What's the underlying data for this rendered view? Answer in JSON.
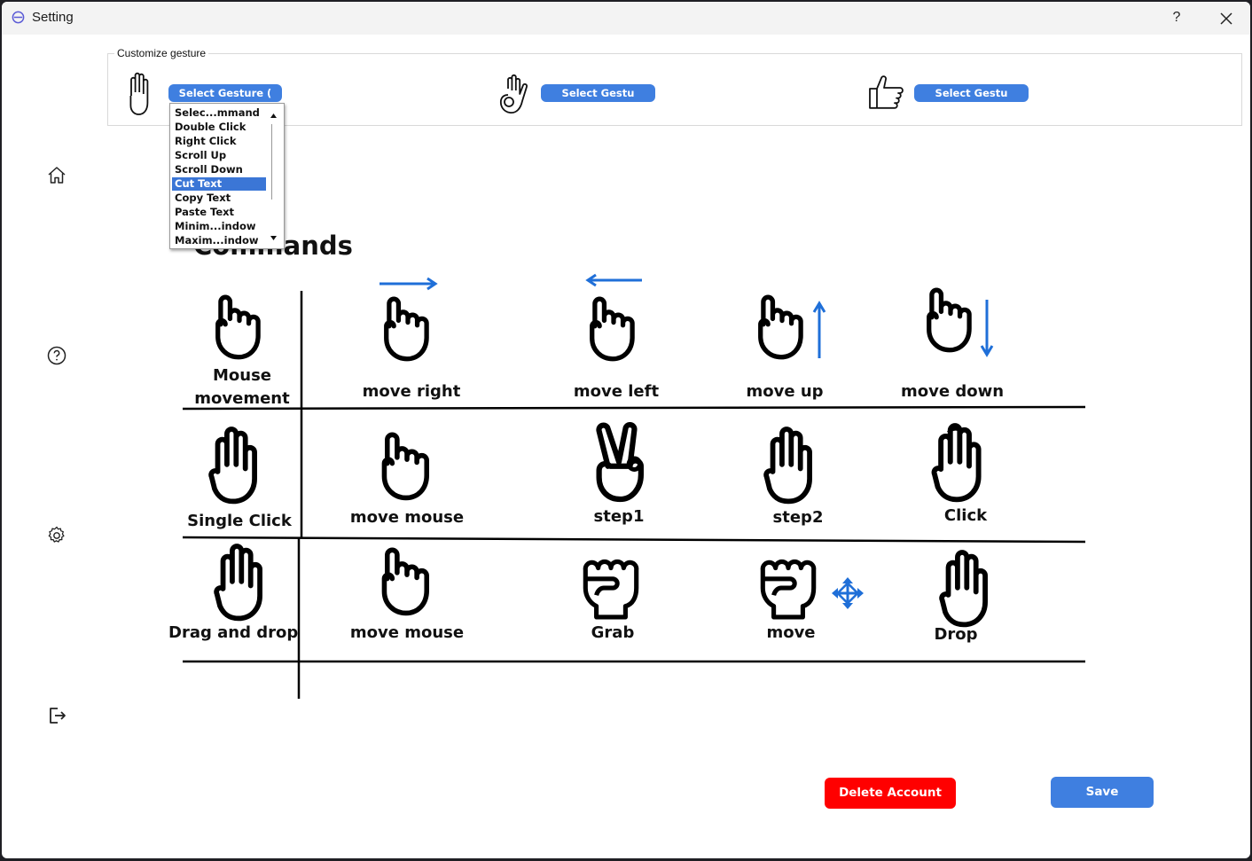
{
  "window": {
    "title": "Setting",
    "help_label": "?"
  },
  "sidebar": {
    "items": [
      {
        "name": "home-icon"
      },
      {
        "name": "help-circle-icon"
      },
      {
        "name": "gear-icon"
      },
      {
        "name": "logout-icon"
      }
    ]
  },
  "customize": {
    "group_title": "Customize gesture",
    "selects": [
      {
        "label": "Select Gesture (",
        "icon": "open-palm-icon"
      },
      {
        "label": "Select Gestu",
        "icon": "ok-hand-icon"
      },
      {
        "label": "Select Gestu",
        "icon": "thumbs-side-hand-icon"
      }
    ],
    "dropdown_options": [
      "Selec...mmand",
      "Double Click",
      "Right Click",
      "Scroll Up",
      "Scroll Down",
      "Cut Text",
      "Copy Text",
      "Paste Text",
      "Minim...indow",
      "Maxim...indow"
    ],
    "dropdown_selected": "Cut Text"
  },
  "commands": {
    "title": "Commands",
    "rows": [
      {
        "name": "Mouse\nmovement",
        "steps": [
          "move right",
          "move left",
          "move up",
          "move down"
        ]
      },
      {
        "name": "Single Click",
        "steps": [
          "move mouse",
          "step1",
          "step2",
          "Click"
        ]
      },
      {
        "name": "Drag and drop",
        "steps": [
          "move mouse",
          "Grab",
          "move",
          "Drop"
        ]
      }
    ]
  },
  "footer": {
    "delete_label": "Delete Account",
    "save_label": "Save"
  },
  "colors": {
    "accent": "#3f7fe0",
    "danger": "#ff0000",
    "arrow": "#1f6fd8"
  }
}
